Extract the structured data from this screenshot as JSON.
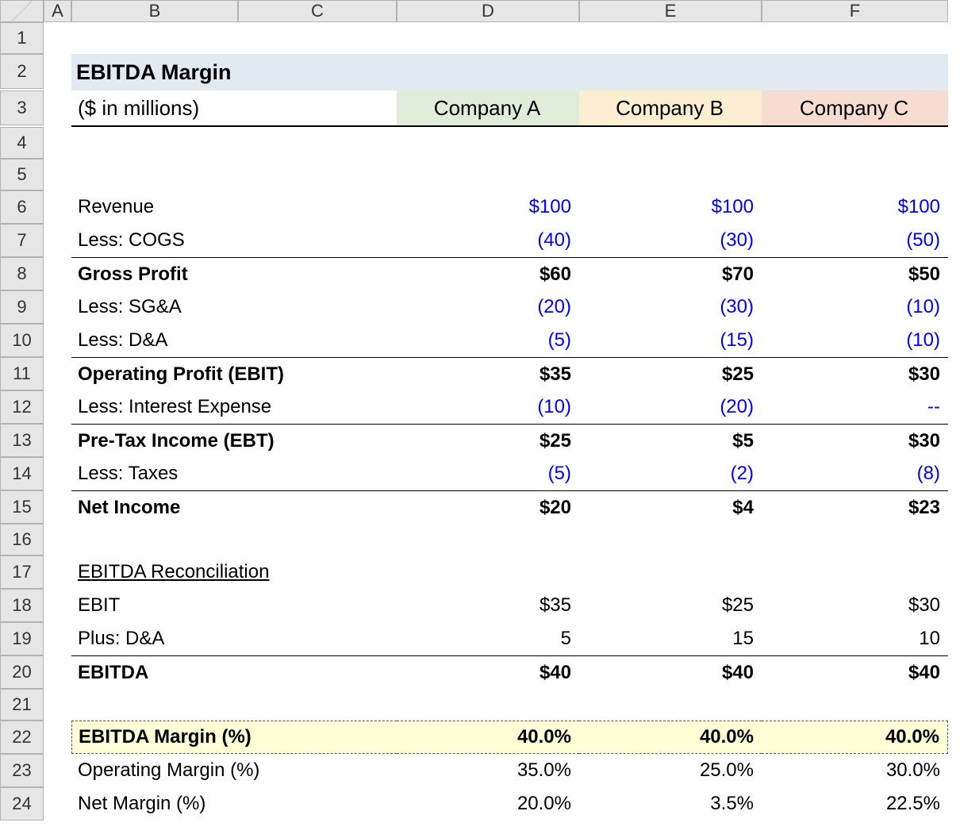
{
  "cols": [
    "A",
    "B",
    "C",
    "D",
    "E",
    "F"
  ],
  "rows": [
    "1",
    "2",
    "3",
    "4",
    "5",
    "6",
    "7",
    "8",
    "9",
    "10",
    "11",
    "12",
    "13",
    "14",
    "15",
    "16",
    "17",
    "18",
    "19",
    "20",
    "21",
    "22",
    "23",
    "24"
  ],
  "title": "EBITDA Margin",
  "subtitle": "($ in millions)",
  "companies": {
    "a": "Company A",
    "b": "Company B",
    "c": "Company C"
  },
  "labels": {
    "revenue": "Revenue",
    "cogs": "Less: COGS",
    "gross": "Gross Profit",
    "sga": "Less: SG&A",
    "da": "Less: D&A",
    "ebit": "Operating Profit (EBIT)",
    "interest": "Less: Interest Expense",
    "ebt": "Pre-Tax Income (EBT)",
    "taxes": "Less: Taxes",
    "netincome": "Net Income",
    "recon": "EBITDA Reconciliation",
    "ebit2": "EBIT",
    "plusda": "Plus: D&A",
    "ebitda": "EBITDA",
    "ebitdamargin": "EBITDA Margin (%)",
    "opmargin": "Operating Margin (%)",
    "netmargin": "Net Margin (%)"
  },
  "vals": {
    "revenue": {
      "a": "$100",
      "b": "$100",
      "c": "$100"
    },
    "cogs": {
      "a": "(40)",
      "b": "(30)",
      "c": "(50)"
    },
    "gross": {
      "a": "$60",
      "b": "$70",
      "c": "$50"
    },
    "sga": {
      "a": "(20)",
      "b": "(30)",
      "c": "(10)"
    },
    "da": {
      "a": "(5)",
      "b": "(15)",
      "c": "(10)"
    },
    "ebit": {
      "a": "$35",
      "b": "$25",
      "c": "$30"
    },
    "interest": {
      "a": "(10)",
      "b": "(20)",
      "c": "--"
    },
    "ebt": {
      "a": "$25",
      "b": "$5",
      "c": "$30"
    },
    "taxes": {
      "a": "(5)",
      "b": "(2)",
      "c": "(8)"
    },
    "netincome": {
      "a": "$20",
      "b": "$4",
      "c": "$23"
    },
    "ebit2": {
      "a": "$35",
      "b": "$25",
      "c": "$30"
    },
    "plusda": {
      "a": "5",
      "b": "15",
      "c": "10"
    },
    "ebitda": {
      "a": "$40",
      "b": "$40",
      "c": "$40"
    },
    "ebitdamargin": {
      "a": "40.0%",
      "b": "40.0%",
      "c": "40.0%"
    },
    "opmargin": {
      "a": "35.0%",
      "b": "25.0%",
      "c": "30.0%"
    },
    "netmargin": {
      "a": "20.0%",
      "b": "3.5%",
      "c": "22.5%"
    }
  },
  "chart_data": {
    "type": "table",
    "title": "EBITDA Margin",
    "subtitle": "($ in millions)",
    "columns": [
      "Company A",
      "Company B",
      "Company C"
    ],
    "rows": [
      {
        "label": "Revenue",
        "values": [
          100,
          100,
          100
        ]
      },
      {
        "label": "Less: COGS",
        "values": [
          -40,
          -30,
          -50
        ]
      },
      {
        "label": "Gross Profit",
        "values": [
          60,
          70,
          50
        ]
      },
      {
        "label": "Less: SG&A",
        "values": [
          -20,
          -30,
          -10
        ]
      },
      {
        "label": "Less: D&A",
        "values": [
          -5,
          -15,
          -10
        ]
      },
      {
        "label": "Operating Profit (EBIT)",
        "values": [
          35,
          25,
          30
        ]
      },
      {
        "label": "Less: Interest Expense",
        "values": [
          -10,
          -20,
          null
        ]
      },
      {
        "label": "Pre-Tax Income (EBT)",
        "values": [
          25,
          5,
          30
        ]
      },
      {
        "label": "Less: Taxes",
        "values": [
          -5,
          -2,
          -8
        ]
      },
      {
        "label": "Net Income",
        "values": [
          20,
          4,
          23
        ]
      },
      {
        "label": "EBIT",
        "values": [
          35,
          25,
          30
        ]
      },
      {
        "label": "Plus: D&A",
        "values": [
          5,
          15,
          10
        ]
      },
      {
        "label": "EBITDA",
        "values": [
          40,
          40,
          40
        ]
      },
      {
        "label": "EBITDA Margin (%)",
        "values": [
          40.0,
          40.0,
          40.0
        ]
      },
      {
        "label": "Operating Margin (%)",
        "values": [
          35.0,
          25.0,
          30.0
        ]
      },
      {
        "label": "Net Margin (%)",
        "values": [
          20.0,
          3.5,
          22.5
        ]
      }
    ]
  }
}
